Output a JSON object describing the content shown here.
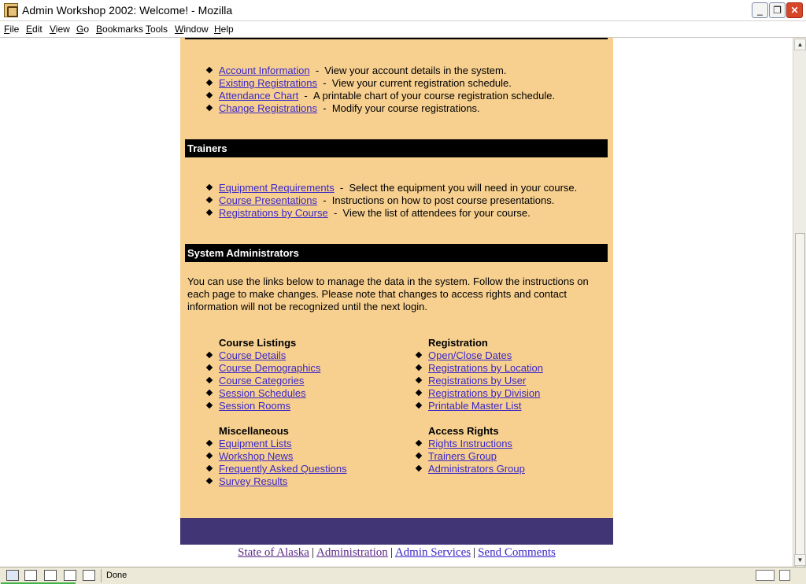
{
  "window": {
    "title": "Admin Workshop 2002: Welcome! - Mozilla",
    "min_glyph": "_",
    "max_glyph": "❐",
    "close_glyph": "✕"
  },
  "menu": [
    "File",
    "Edit",
    "View",
    "Go",
    "Bookmarks",
    "Tools",
    "Window",
    "Help"
  ],
  "participants": {
    "items": [
      {
        "link": "Account Information",
        "desc": "View your account details in the system."
      },
      {
        "link": "Existing Registrations",
        "desc": "View your current registration schedule."
      },
      {
        "link": "Attendance Chart",
        "desc": "A printable chart of your course registration schedule."
      },
      {
        "link": "Change Registrations",
        "desc": "Modify your course registrations."
      }
    ]
  },
  "trainers": {
    "heading": "Trainers",
    "items": [
      {
        "link": "Equipment Requirements",
        "desc": "Select the equipment you will need in your course."
      },
      {
        "link": "Course Presentations",
        "desc": "Instructions on how to post course presentations."
      },
      {
        "link": "Registrations by Course",
        "desc": "View the list of attendees for your course."
      }
    ]
  },
  "sysadmin": {
    "heading": "System Administrators",
    "paragraph": "You can use the links below to manage the data in the system. Follow the instructions on each page to make changes. Please note that changes to access rights and contact information will not be recognized until the next login.",
    "groups": {
      "course_listings": {
        "heading": "Course Listings",
        "links": [
          "Course Details",
          "Course Demographics",
          "Course Categories",
          "Session Schedules",
          "Session Rooms"
        ]
      },
      "registration": {
        "heading": "Registration",
        "links": [
          "Open/Close Dates",
          "Registrations by Location",
          "Registrations by User",
          "Registrations by Division",
          "Printable Master List"
        ]
      },
      "miscellaneous": {
        "heading": "Miscellaneous",
        "links": [
          "Equipment Lists",
          "Workshop News",
          "Frequently Asked Questions",
          "Survey Results"
        ]
      },
      "access_rights": {
        "heading": "Access Rights",
        "links": [
          "Rights Instructions",
          "Trainers Group",
          "Administrators Group"
        ]
      }
    }
  },
  "footer": {
    "links": [
      "State of Alaska",
      "Administration",
      "Admin Services",
      "Send Comments"
    ],
    "separator": "|"
  },
  "status": {
    "text": "Done"
  },
  "colors": {
    "panel_bg": "#f7d090",
    "footer_band": "#423576",
    "link": "#3b27c6",
    "visited_link": "#5b2a86"
  }
}
